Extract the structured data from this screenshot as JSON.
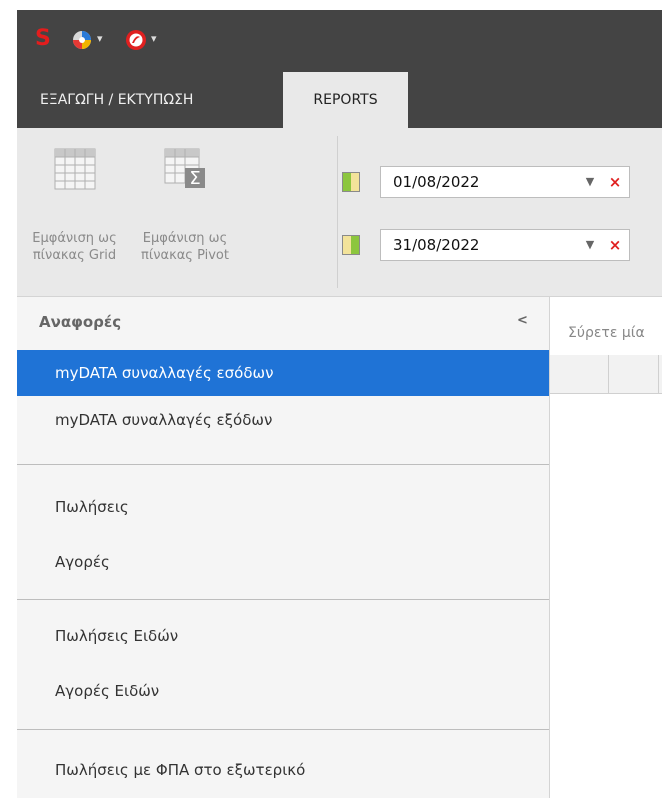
{
  "quick_access": {
    "app_logo": "S",
    "icons": [
      "color-palette-icon",
      "style-theme-icon"
    ]
  },
  "tabs": [
    {
      "label": "ΕΞΑΓΩΓΗ / ΕΚΤΥΠΩΣΗ",
      "active": false
    },
    {
      "label": "REPORTS",
      "active": true
    }
  ],
  "ribbon": {
    "grid_button_label": "Εμφάνιση ως πίνακας Grid",
    "pivot_button_label": "Εμφάνιση ως πίνακας Pivot",
    "date_from": "01/08/2022",
    "date_to": "31/08/2022"
  },
  "panel": {
    "title": "Αναφορές",
    "items": [
      {
        "label": "myDATA συναλλαγές εσόδων",
        "active": true
      },
      {
        "label": "myDATA συναλλαγές εξόδων",
        "active": false
      },
      {
        "label": "Πωλήσεις",
        "active": false
      },
      {
        "label": "Αγορές",
        "active": false
      },
      {
        "label": "Πωλήσεις Ειδών",
        "active": false
      },
      {
        "label": "Αγορές Ειδών",
        "active": false
      },
      {
        "label": "Πωλήσεις με ΦΠΑ στο εξωτερικό",
        "active": false
      }
    ]
  },
  "content": {
    "group_panel_text": "Σύρετε μία"
  },
  "colors": {
    "dark_bar": "#444444",
    "ribbon_bg": "#e9e9e9",
    "selection_blue": "#1f73d6",
    "clear_red": "#e02020"
  }
}
